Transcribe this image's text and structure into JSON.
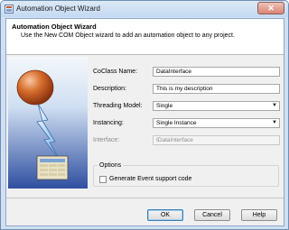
{
  "window": {
    "title": "Automation Object Wizard"
  },
  "header": {
    "title": "Automation Object Wizard",
    "description": "Use the New COM Object wizard to add an automation object to any project."
  },
  "form": {
    "coclass_label": "CoClass Name:",
    "coclass_value": "DataInterface",
    "description_label": "Description:",
    "description_value": "This is my description",
    "threading_label": "Threading Model:",
    "threading_value": "Single",
    "instancing_label": "Instancing:",
    "instancing_value": "Single Instance",
    "interface_label": "Interface:",
    "interface_value": "IDataInterface"
  },
  "options": {
    "legend": "Options",
    "generate_events_label": "Generate Event support code",
    "generate_events_checked": false
  },
  "buttons": {
    "ok": "OK",
    "cancel": "Cancel",
    "help": "Help"
  },
  "colors": {
    "title_bar": "#c4d9f1",
    "close_button": "#d98575",
    "panel_background": "#f0f0f0",
    "image_gradient_bottom": "#2f4fa0",
    "sphere_orange": "#c8571d",
    "lightning_blue": "#5fa2e0"
  },
  "icons": {
    "title": "wizard-icon",
    "close": "close-icon",
    "dropdown": "chevron-down-icon",
    "side_image": "automation-object-illustration"
  }
}
